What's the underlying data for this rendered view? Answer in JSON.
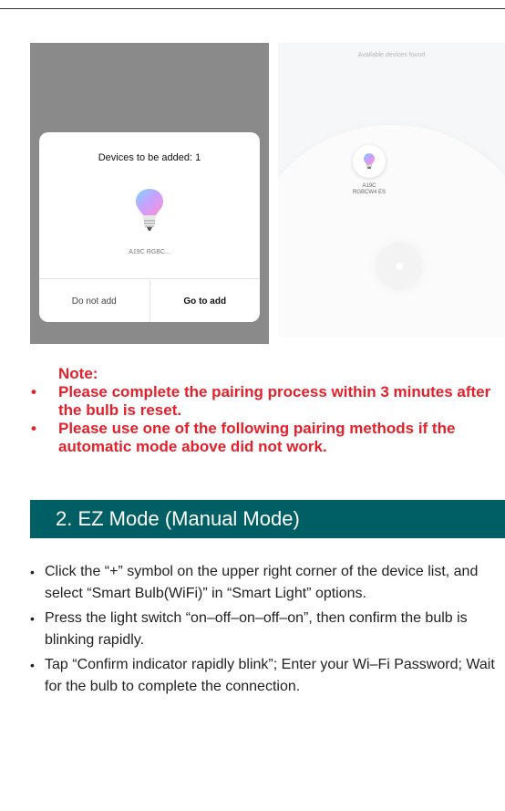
{
  "dialog": {
    "title": "Devices to be added: 1",
    "device_name": "A19C RGBC...",
    "btn_no": "Do not add",
    "btn_go": "Go to add"
  },
  "scan": {
    "found_text": "Available devices found",
    "device_line1": "A19C",
    "device_line2": "RGBCW4 ES"
  },
  "note": {
    "title": "Note:",
    "bullet": "•",
    "items": [
      "Please complete the pairing process within 3 minutes after the bulb is reset.",
      "Please use one of the following pairing methods if the automatic mode above did not work."
    ]
  },
  "section": {
    "title": "2. EZ Mode (Manual Mode)"
  },
  "steps": {
    "bullet": "•",
    "items": [
      "Click the “+” symbol on the upper right corner of the device list, and select “Smart Bulb(WiFi)” in “Smart Light” options.",
      "Press the light switch “on–off–on–off–on”, then confirm the bulb is blinking rapidly.",
      "Tap “Confirm indicator rapidly blink”; Enter your Wi–Fi Password; Wait for the bulb to complete the connection."
    ]
  },
  "colors": {
    "note_red": "#e4212b",
    "section_teal": "#005f65",
    "overlay_gray": "#8a8a8a"
  }
}
